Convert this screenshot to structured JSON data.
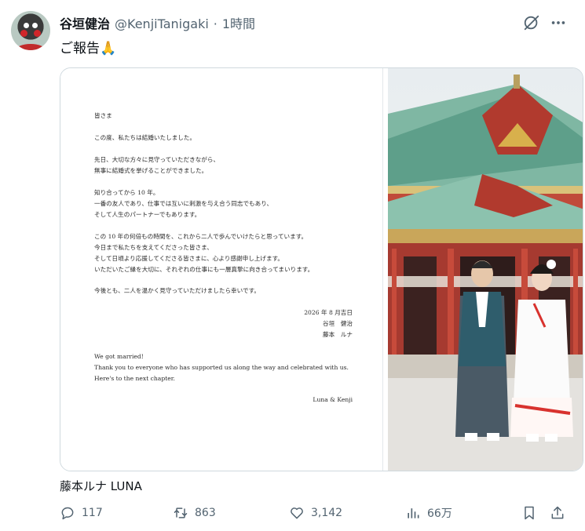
{
  "user": {
    "display_name": "谷垣健治",
    "handle": "@KenjiTanigaki",
    "separator": "·",
    "time": "1時間"
  },
  "tweet": {
    "text": "ご報告🙏"
  },
  "letter": {
    "lines": [
      "皆さま",
      "この度、私たちは結婚いたしました。",
      "先日、大切な方々に見守っていただきながら、",
      "無事に結婚式を挙げることができました。",
      "知り合ってから 10 年。",
      "一番の友人であり、仕事では互いに刺激を与え合う同志でもあり、",
      "そして人生のパートナーでもあります。",
      "この 10 年の何倍もの時間を、これから二人で歩んでいけたらと思っています。",
      "今日まで私たちを支えてくださった皆さま、",
      "そして日頃より応援してくださる皆さまに、心より感謝申し上げます。",
      "いただいたご縁を大切に、それぞれの仕事にも一層真摯に向き合ってまいります。",
      "今後とも、二人を温かく見守っていただけましたら幸いです。"
    ],
    "date": "2026 年 8 月吉日",
    "signer1": "谷垣　健治",
    "signer2": "藤本　ルナ",
    "english_lines": [
      "We got married!",
      "Thank you to everyone who has supported us along the way and celebrated with us.",
      "Here's to the next chapter."
    ],
    "english_sign": "Luna & Kenji"
  },
  "tagged_user": "藤本ルナ LUNA",
  "actions": {
    "replies": "117",
    "reposts": "863",
    "likes": "3,142",
    "views": "66万"
  },
  "icons": [
    "grok-icon",
    "more-icon",
    "reply-icon",
    "repost-icon",
    "like-icon",
    "views-icon",
    "bookmark-icon",
    "share-icon"
  ],
  "colors": {
    "text": "#0f1419",
    "secondary": "#536471",
    "border": "#cfd9de"
  }
}
